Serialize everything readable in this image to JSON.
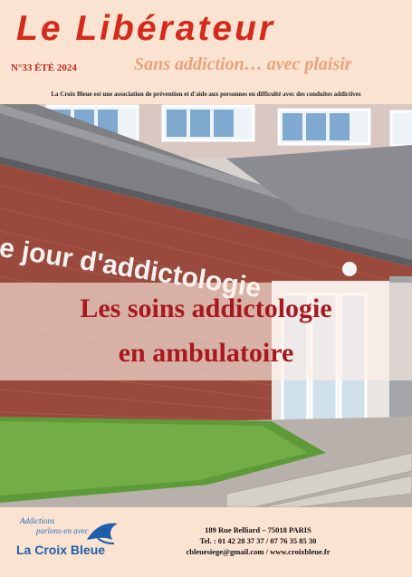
{
  "masthead": {
    "title": "Le Libérateur",
    "issue": "N°33 ÉTÉ 2024",
    "slogan": "Sans addiction… avec plaisir",
    "tagline": "La Croix Bleue est une association de prévention et d'aide aux personnes en difficulté avec des conduites addictives"
  },
  "photo": {
    "sign_text": "e jour d'addictologie"
  },
  "headline": {
    "line1": "Les soins addictologie",
    "line2": "en ambulatoire"
  },
  "footer": {
    "logo_script_line1": "Addictions",
    "logo_script_line2": "parlons-en avec",
    "logo_name": "La Croix Bleue",
    "address": "189 Rue Belliard – 75018 PARIS",
    "phone": "Tel. : 01 42 28 37 37 / 07 76 35 85 30",
    "contact": "cbleuesiege@gmail.com / www.croixbleue.fr"
  },
  "colors": {
    "title_red": "#d42a1c",
    "headline_red": "#a8191f",
    "slogan_peach": "#e8a37c",
    "brand_blue": "#1f5ea8",
    "background": "#fbe3d2"
  }
}
